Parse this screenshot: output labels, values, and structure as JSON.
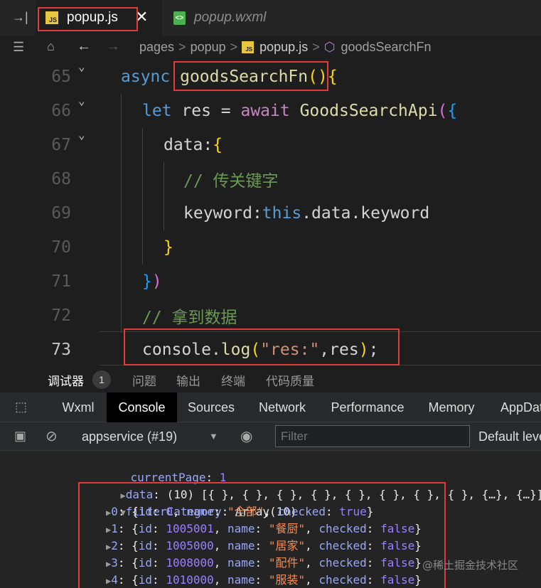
{
  "tabs": [
    {
      "label": "popup.js",
      "icon": "js-file-icon",
      "active": true
    },
    {
      "label": "popup.wxml",
      "icon": "wxml-file-icon",
      "active": false
    }
  ],
  "tab_close": "✕",
  "breadcrumb": {
    "parts": [
      "pages",
      "popup",
      "popup.js",
      "goodsSearchFn"
    ],
    "sep": ">"
  },
  "editor": {
    "lines": [
      {
        "num": "65",
        "tokens": [
          [
            "kw2",
            "async "
          ],
          [
            "fn",
            "goodsSearchFn"
          ],
          [
            "br1",
            "()"
          ],
          [
            "br1",
            "{"
          ]
        ]
      },
      {
        "num": "66",
        "tokens": [
          [
            "kw2",
            "let "
          ],
          [
            "var",
            "res "
          ],
          [
            "plain",
            "= "
          ],
          [
            "kw",
            "await "
          ],
          [
            "fn",
            "GoodsSearchApi"
          ],
          [
            "br2",
            "("
          ],
          [
            "br3",
            "{"
          ]
        ]
      },
      {
        "num": "67",
        "tokens": [
          [
            "plain",
            "data"
          ],
          [
            "plain",
            ":"
          ],
          [
            "br1",
            "{"
          ]
        ]
      },
      {
        "num": "68",
        "tokens": [
          [
            "cmt",
            "// 传关键字"
          ]
        ]
      },
      {
        "num": "69",
        "tokens": [
          [
            "plain",
            "keyword"
          ],
          [
            "plain",
            ":"
          ],
          [
            "kw2",
            "this"
          ],
          [
            "plain",
            "."
          ],
          [
            "plain",
            "data"
          ],
          [
            "plain",
            "."
          ],
          [
            "plain",
            "keyword"
          ]
        ]
      },
      {
        "num": "70",
        "tokens": [
          [
            "br1",
            "}"
          ]
        ]
      },
      {
        "num": "71",
        "tokens": [
          [
            "br3",
            "}"
          ],
          [
            "br2",
            ")"
          ]
        ]
      },
      {
        "num": "72",
        "tokens": [
          [
            "cmt",
            "// 拿到数据"
          ]
        ]
      },
      {
        "num": "73",
        "tokens": [
          [
            "plain",
            "console"
          ],
          [
            "plain",
            "."
          ],
          [
            "fn",
            "log"
          ],
          [
            "br1",
            "("
          ],
          [
            "str",
            "\"res:\""
          ],
          [
            "plain",
            ","
          ],
          [
            "plain",
            "res"
          ],
          [
            "br1",
            ")"
          ],
          [
            "plain",
            ";"
          ]
        ]
      }
    ]
  },
  "panel": {
    "debugger": "调试器",
    "count": "1",
    "problems": "问题",
    "output": "输出",
    "terminal": "终端",
    "code_quality": "代码质量"
  },
  "devtools": {
    "tabs": [
      "Wxml",
      "Console",
      "Sources",
      "Network",
      "Performance",
      "Memory",
      "AppDat"
    ],
    "active": "Console"
  },
  "console_toolbar": {
    "context": "appservice (#19)",
    "filter_placeholder": "Filter",
    "levels": "Default leve"
  },
  "console": {
    "currentPage_key": "currentPage",
    "currentPage_val": "1",
    "data_line": "(10) [{ }, { }, { }, { }, { }, { }, { }, { }, {…}, {…}]",
    "filter_key": "filterCategory",
    "filter_val": "Array(10)",
    "items": [
      {
        "idx": "0",
        "id": "0",
        "name": "\"全部\"",
        "checked": "true"
      },
      {
        "idx": "1",
        "id": "1005001",
        "name": "\"餐厨\"",
        "checked": "false"
      },
      {
        "idx": "2",
        "id": "1005000",
        "name": "\"居家\"",
        "checked": "false"
      },
      {
        "idx": "3",
        "id": "1008000",
        "name": "\"配件\"",
        "checked": "false"
      },
      {
        "idx": "4",
        "id": "1010000",
        "name": "\"服装\"",
        "checked": "false"
      }
    ]
  },
  "watermark": "@稀土掘金技术社区"
}
